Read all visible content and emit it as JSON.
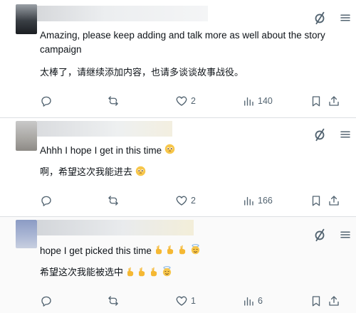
{
  "posts": [
    {
      "text": "Amazing, please keep adding and talk more as well about the story",
      "text_line2": "campaign",
      "translation": "太棒了，请继续添加内容，也请多谈谈故事战役。",
      "likes": "2",
      "views": "140"
    },
    {
      "text": "Ahhh I hope I get in this time",
      "translation": "啊，希望这次我能进去",
      "likes": "2",
      "views": "166"
    },
    {
      "text": "hope I get picked this time",
      "translation": "希望这次我能被选中",
      "likes": "1",
      "views": "6"
    }
  ],
  "icons": {
    "more": "grok-slash-icon",
    "menu": "hamburger-menu-icon",
    "reply": "reply-icon",
    "repost": "repost-icon",
    "like": "heart-icon",
    "views": "analytics-icon",
    "bookmark": "bookmark-icon",
    "share": "share-icon"
  },
  "colors": {
    "text": "#0f1419",
    "muted": "#536471",
    "divider": "#dcdfe3"
  }
}
